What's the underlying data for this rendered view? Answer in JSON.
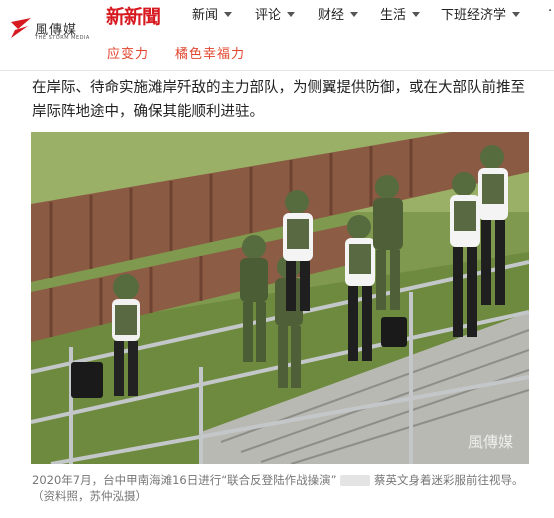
{
  "site": {
    "logo_cn": "風傳媒",
    "logo_en": "THE STORM MEDIA",
    "brand_news": "新新聞"
  },
  "nav": [
    {
      "label": "新闻"
    },
    {
      "label": "评论"
    },
    {
      "label": "财经"
    },
    {
      "label": "生活"
    },
    {
      "label": "下班经济学"
    }
  ],
  "nav_overflow": "·",
  "subnav": [
    {
      "label": "应变力"
    },
    {
      "label": "橘色幸福力"
    }
  ],
  "article": {
    "paragraph": "在岸际、待命实施滩岸歼敌的主力部队，为侧翼提供防御，或在大部队前推至岸际阵地途中，确保其能顺利进驻。",
    "photo_watermark": "風傳媒",
    "caption_before": "2020年7月，台中甲南海滩16日进行“联合反登陆作战操演”",
    "caption_after": "蔡英文身着迷彩服前往视导。（资料照，苏仲泓摄）"
  },
  "colors": {
    "brand_red": "#d71920",
    "subnav_orange": "#e0452d"
  }
}
